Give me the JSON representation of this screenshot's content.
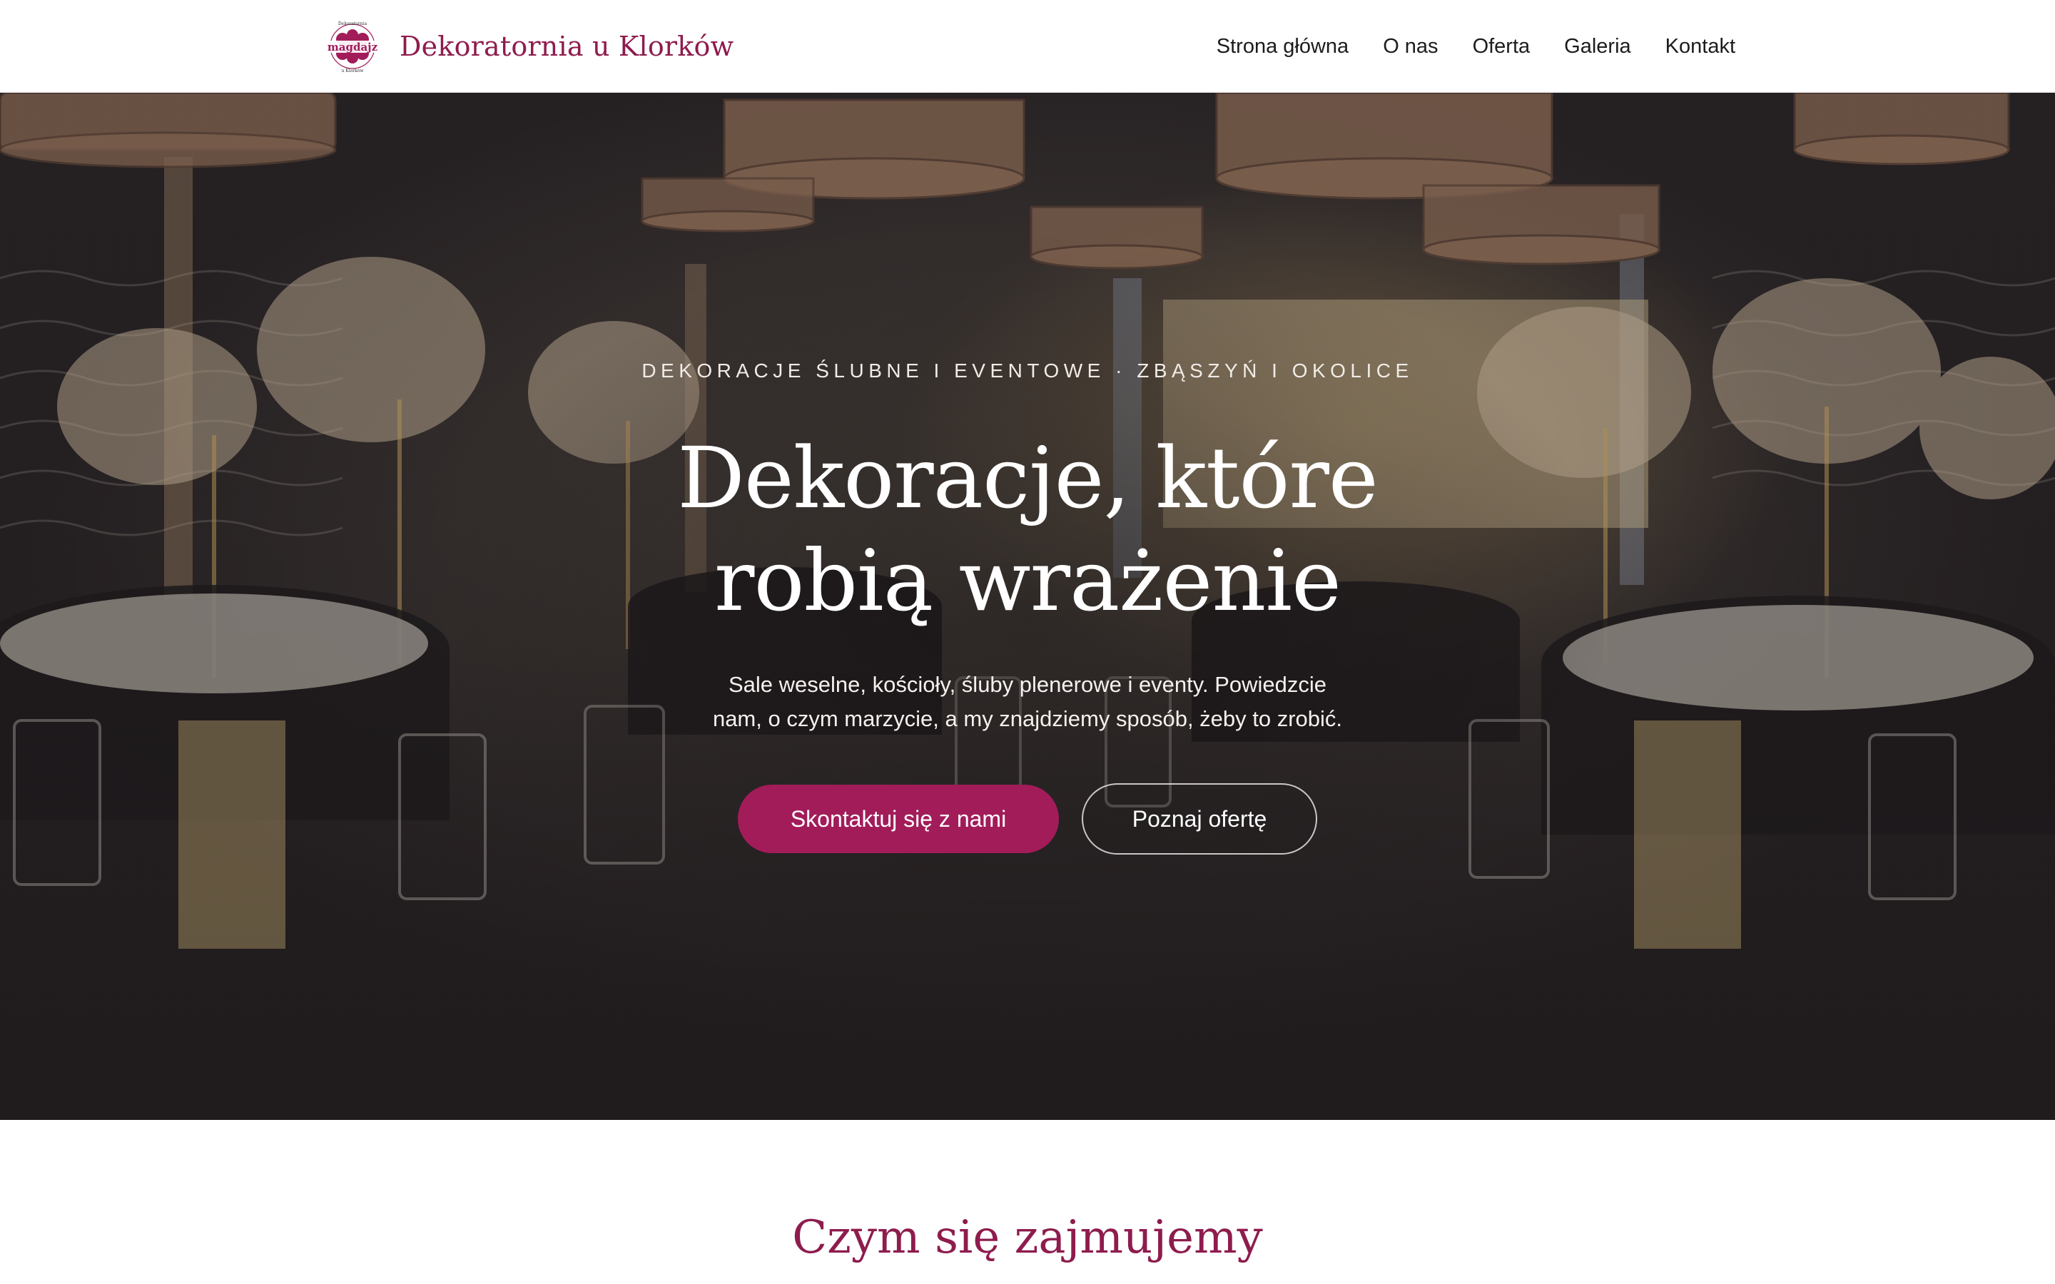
{
  "header": {
    "brand_name": "Dekoratornia u Klorków",
    "logo": {
      "icon": "flower-badge-logo",
      "wordmark": "magdajz",
      "top_text": "Dekoratornia",
      "bottom_text": "u Klorków"
    },
    "nav": [
      {
        "label": "Strona główna"
      },
      {
        "label": "O nas"
      },
      {
        "label": "Oferta"
      },
      {
        "label": "Galeria"
      },
      {
        "label": "Kontakt"
      }
    ]
  },
  "hero": {
    "eyebrow": "DEKORACJE ŚLUBNE I EVENTOWE · ZBĄSZYŃ I OKOLICE",
    "title_line1": "Dekoracje, które",
    "title_line2": "robią wrażenie",
    "subtitle_line1": "Sale weselne, kościoły, śluby plenerowe i eventy. Powiedzcie",
    "subtitle_line2": "nam, o czym marzycie, a my znajdziemy sposób, żeby to zrobić.",
    "primary_button": "Skontaktuj się z nami",
    "secondary_button": "Poznaj ofertę",
    "background_image": "banquet-hall-photo"
  },
  "section": {
    "title": "Czym się zajmujemy"
  },
  "colors": {
    "brand": "#8e1c4d",
    "primary_button": "#a21c5a",
    "hero_overlay": "#2b2628"
  }
}
